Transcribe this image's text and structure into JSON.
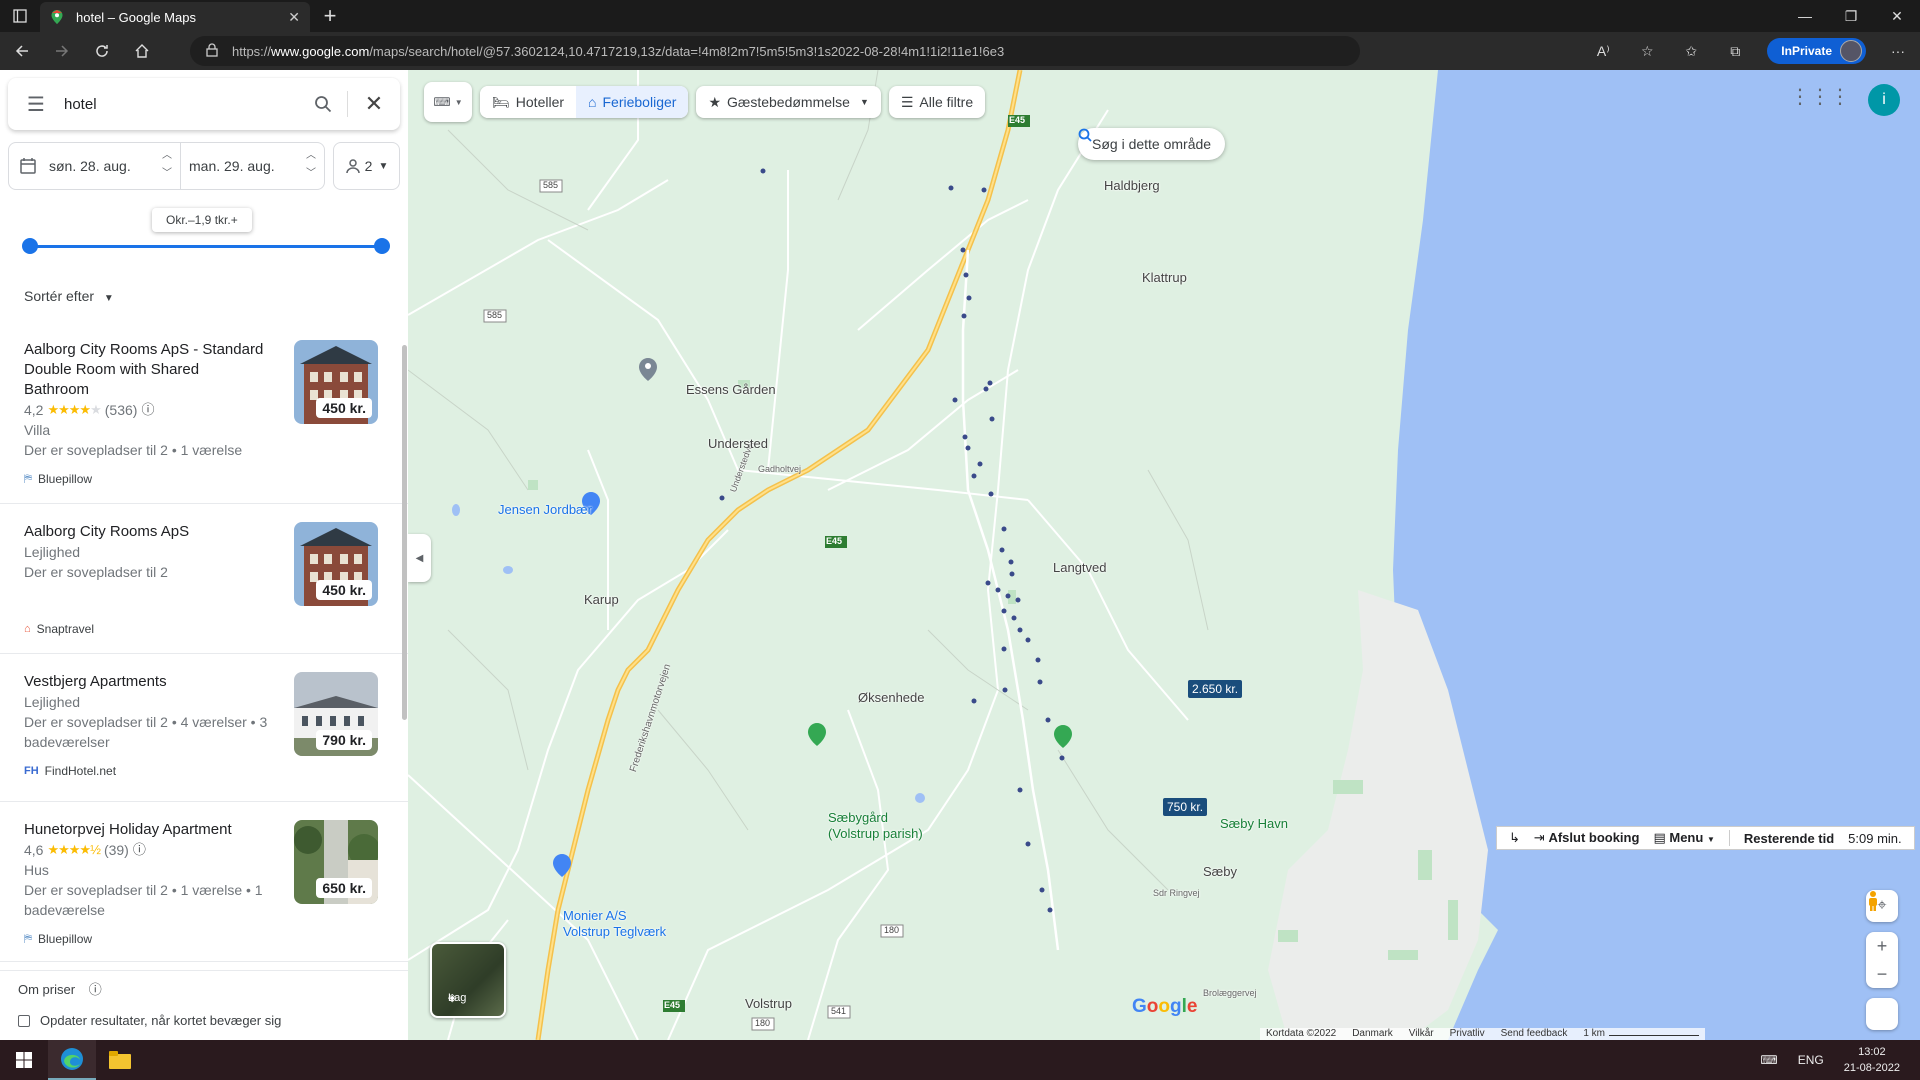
{
  "browser": {
    "tab_title": "hotel – Google Maps",
    "url_prefix": "https://",
    "url_host": "www.google.com",
    "url_path": "/maps/search/hotel/@57.3602124,10.4717219,13z/data=!4m8!2m7!5m5!5m3!1s2022-08-28!4m1!1i2!11e1!6e3",
    "inprivate_label": "InPrivate"
  },
  "search": {
    "query": "hotel"
  },
  "filters": {
    "checkin": "søn. 28. aug.",
    "checkout": "man. 29. aug.",
    "guests": "2",
    "price_range": "Okr.–1,9 tkr.+",
    "sort_label": "Sortér efter"
  },
  "listings": [
    {
      "name": "Aalborg City Rooms ApS - Standard Double Room with Shared Bathroom",
      "rating": "4,2",
      "stars": 4,
      "reviews": "(536)",
      "type": "Villa",
      "desc": "Der er sovepladser til 2 • 1 værelse",
      "source": "Bluepillow",
      "price": "450 kr."
    },
    {
      "name": "Aalborg City Rooms ApS",
      "type": "Lejlighed",
      "desc": "Der er sovepladser til 2",
      "source": "Snaptravel",
      "price": "450 kr."
    },
    {
      "name": "Vestbjerg Apartments",
      "type": "Lejlighed",
      "desc": "Der er sovepladser til 2 • 4 værelser • 3 badeværelser",
      "source": "FindHotel.net",
      "price": "790 kr."
    },
    {
      "name": "Hunetorpvej Holiday Apartment",
      "rating": "4,6",
      "stars": 4.5,
      "reviews": "(39)",
      "type": "Hus",
      "desc": "Der er sovepladser til 2 • 1 værelse • 1 badeværelse",
      "source": "Bluepillow",
      "price": "650 kr."
    }
  ],
  "footer": {
    "about_prices": "Om priser",
    "update_results": "Opdater resultater, når kortet bevæger sig"
  },
  "map": {
    "chips": {
      "hotels": "Hoteller",
      "vacation": "Ferieboliger",
      "guest_rating": "Gæstebedømmelse",
      "all_filters": "Alle filtre"
    },
    "search_area": "Søg i dette område",
    "profile_initial": "i",
    "places": {
      "haldbjerg": "Haldbjerg",
      "klattrup": "Klattrup",
      "essens": "Essens Gården",
      "understed": "Understed",
      "jensen": "Jensen Jordbær",
      "langtved": "Langtved",
      "karup": "Karup",
      "oksenhede": "Øksenhede",
      "saebygaard": "Sæbygård\n(Volstrup parish)",
      "saeby_havn": "Sæby Havn",
      "saeby": "Sæby",
      "monier": "Monier A/S\nVolstrup Teglværk",
      "volstrup": "Volstrup"
    },
    "road_labels": {
      "e45a": "E45",
      "e45b": "E45",
      "e45c": "E45",
      "r585a": "585",
      "r585b": "585",
      "r180a": "180",
      "r180b": "180",
      "r541": "541",
      "gadholtvej": "Gadholtvej",
      "frederikshavn": "Frederikshavnmotorvejen",
      "understedvej": "Understedvej",
      "sdr_ringvej": "Sdr Ringvej",
      "brolaeggervej": "Brolæggervej"
    },
    "price_pins": [
      "2.650 kr.",
      "750 kr."
    ],
    "layer_label": "Lag",
    "extension": {
      "finish": "Afslut booking",
      "menu": "Menu",
      "remaining_label": "Resterende tid",
      "remaining_value": "5:09 min."
    },
    "google": "Google",
    "attribution": {
      "data": "Kortdata ©2022",
      "country": "Danmark",
      "terms": "Vilkår",
      "privacy": "Privatliv",
      "feedback": "Send feedback",
      "scale": "1 km"
    }
  },
  "taskbar": {
    "lang": "ENG",
    "time": "13:02",
    "date": "21-08-2022"
  },
  "colors": {
    "accent": "#1a73e8",
    "water": "#9fc0f5",
    "land": "#dff0e2",
    "highway": "#f4c14b"
  }
}
